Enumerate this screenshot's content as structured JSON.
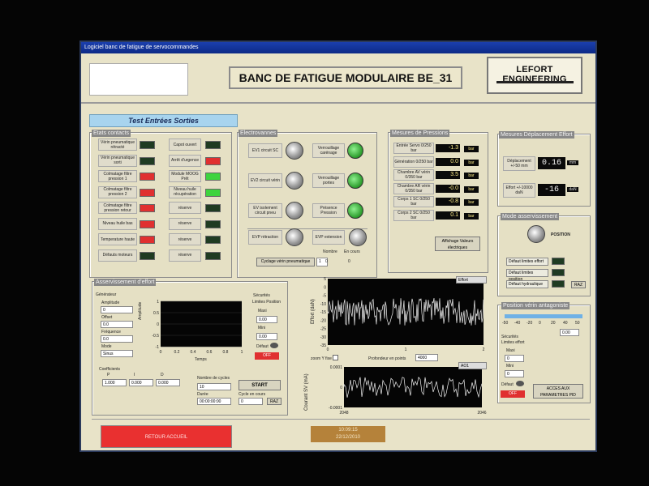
{
  "window": {
    "title": "Logiciel banc de fatigue de servocommandes"
  },
  "header": {
    "title": "BANC DE FATIGUE MODULAIRE BE_31",
    "brand": "LEFORT ENGINEERING"
  },
  "tab": {
    "label": "Test Entrées Sorties"
  },
  "etats": {
    "title": "Etats contacts",
    "left": [
      {
        "label": "Vérin pneumatique rétracté",
        "state": "dark"
      },
      {
        "label": "Vérin pneumatique sorti",
        "state": "dark"
      },
      {
        "label": "Colmatage filtre pression 1",
        "state": "red"
      },
      {
        "label": "Colmatage filtre pression 2",
        "state": "red"
      },
      {
        "label": "Colmatage filtre pression retour",
        "state": "red"
      },
      {
        "label": "Niveau huile bas",
        "state": "red"
      },
      {
        "label": "Temperature haute",
        "state": "red"
      },
      {
        "label": "Défauts moteurs",
        "state": "dark"
      }
    ],
    "right": [
      {
        "label": "Capot ouvert",
        "state": "dark"
      },
      {
        "label": "Arrêt d'urgence",
        "state": "red"
      },
      {
        "label": "Module MOOG Prêt",
        "state": "green"
      },
      {
        "label": "Niveau huile récupération",
        "state": "green"
      },
      {
        "label": "réserve",
        "state": "dark"
      },
      {
        "label": "réserve",
        "state": "dark"
      },
      {
        "label": "réserve",
        "state": "dark"
      },
      {
        "label": "réserve",
        "state": "dark"
      }
    ]
  },
  "electrovannes": {
    "title": "Electrovannes",
    "left": [
      "EV1 circuit SC",
      "EV2 circuit vérin",
      "EV isolement circuit pneu",
      "EVP rétraction"
    ],
    "right": [
      "Verrouillage carénage",
      "Verrouillage portes",
      "Présence Pression",
      "EVP extension"
    ],
    "cyclage_label": "Cyclage vérin pneumatique",
    "cyclage_value": "1",
    "nombre_label": "Nombre",
    "nombre_value": "0",
    "encours_label": "En cours",
    "encours_value": "0"
  },
  "pressions": {
    "title": "Mesures de Pressions",
    "rows": [
      {
        "label": "Entrée Servo 0/250 bar",
        "value": "-1.3",
        "unit": "bar"
      },
      {
        "label": "Génération 0/250 bar",
        "value": "0.0",
        "unit": "bar"
      },
      {
        "label": "Chambre AV vérin 0/350 bar",
        "value": "3.5",
        "unit": "bar"
      },
      {
        "label": "Chambre AR vérin 0/350 bar",
        "value": "-0.0",
        "unit": "bar"
      },
      {
        "label": "Corps 1 SC 0/250 bar",
        "value": "-0.8",
        "unit": "bar"
      },
      {
        "label": "Corps 2 SC 0/250 bar",
        "value": "0.1",
        "unit": "bar"
      }
    ],
    "affichage_button": "Affichage Valeurs électriques"
  },
  "deplacement": {
    "title": "Mesures Déplacement Effort",
    "rows": [
      {
        "label": "Déplacement +/-50 mm",
        "value": "0.16",
        "unit": "mm"
      },
      {
        "label": "Effort +/-10000 daN",
        "value": "-16",
        "unit": "daN"
      }
    ]
  },
  "mode": {
    "title": "Mode asservissement",
    "position_label": "POSITION",
    "defaults": [
      "Défaut limites effort",
      "Défaut limites position",
      "Défaut hydraulique"
    ],
    "raz": "RAZ"
  },
  "asservissement": {
    "title": "Asservissement d'effort",
    "generateur": "Générateur",
    "fields": [
      {
        "label": "Amplitude",
        "value": "0"
      },
      {
        "label": "Offset",
        "value": "0.0"
      },
      {
        "label": "Fréquence",
        "value": "0.0"
      },
      {
        "label": "Mode",
        "value": "Sinus"
      }
    ],
    "plot_ylabel": "Amplitude",
    "plot_xlabel": "Temps",
    "plot_yticks": [
      "1",
      "0.5",
      "0",
      "-0.5",
      "-1"
    ],
    "plot_xticks": [
      "0",
      "0.2",
      "0.4",
      "0.6",
      "0.8",
      "1"
    ],
    "securites": "Sécurités",
    "limites": "Limites Position",
    "maxi_label": "Maxi",
    "maxi_value": "0.00",
    "mini_label": "Mini",
    "mini_value": "0.00",
    "defaut_label": "Défaut",
    "off": "OFF",
    "coefficients": "Coefficients",
    "coef_labels": [
      "P",
      "I",
      "D"
    ],
    "coef_values": [
      "1.000",
      "0.000",
      "0.000"
    ],
    "cycles_label": "Nombre de cycles",
    "cycles_value": "10",
    "duree_label": "Durée",
    "duree_value": "00:00:00:00",
    "start": "START",
    "cycle_en_cours_label": "Cycle en cours",
    "cycle_en_cours_value": "0",
    "raz": "RAZ"
  },
  "effort_plot": {
    "legend": "Effort",
    "ylabel": "Effort (daN)",
    "yticks": [
      "5",
      "0",
      "-5",
      "-10",
      "-15",
      "-20",
      "-25",
      "-30",
      "-35"
    ],
    "xticks": [
      "0",
      "1",
      "2"
    ],
    "zoom_label": "zoom Y fixe",
    "profondeur_label": "Profondeur en points",
    "profondeur_value": "4000"
  },
  "courant_plot": {
    "legend": "AO1",
    "ylabel": "Courant SV (mA)",
    "yticks": [
      "0.0001",
      "0",
      "-0.0001"
    ],
    "xticks": [
      "2048",
      "2046"
    ]
  },
  "antagoniste": {
    "title": "Position vérin antagoniste",
    "scale": [
      "-50",
      "-40",
      "-20",
      "0",
      "20",
      "40",
      "50"
    ],
    "value": "0.00",
    "securites": "Sécurités",
    "limites": "Limites effort",
    "maxi_label": "Maxi",
    "maxi_value": "0",
    "mini_label": "Mini",
    "mini_value": "0",
    "defaut_label": "Défaut",
    "off": "OFF",
    "acces_button": "ACCES AUX PARAMETRES PID"
  },
  "footer": {
    "accueil": "RETOUR ACCUEIL",
    "time": "10:09:15",
    "date": "22/12/2010"
  }
}
